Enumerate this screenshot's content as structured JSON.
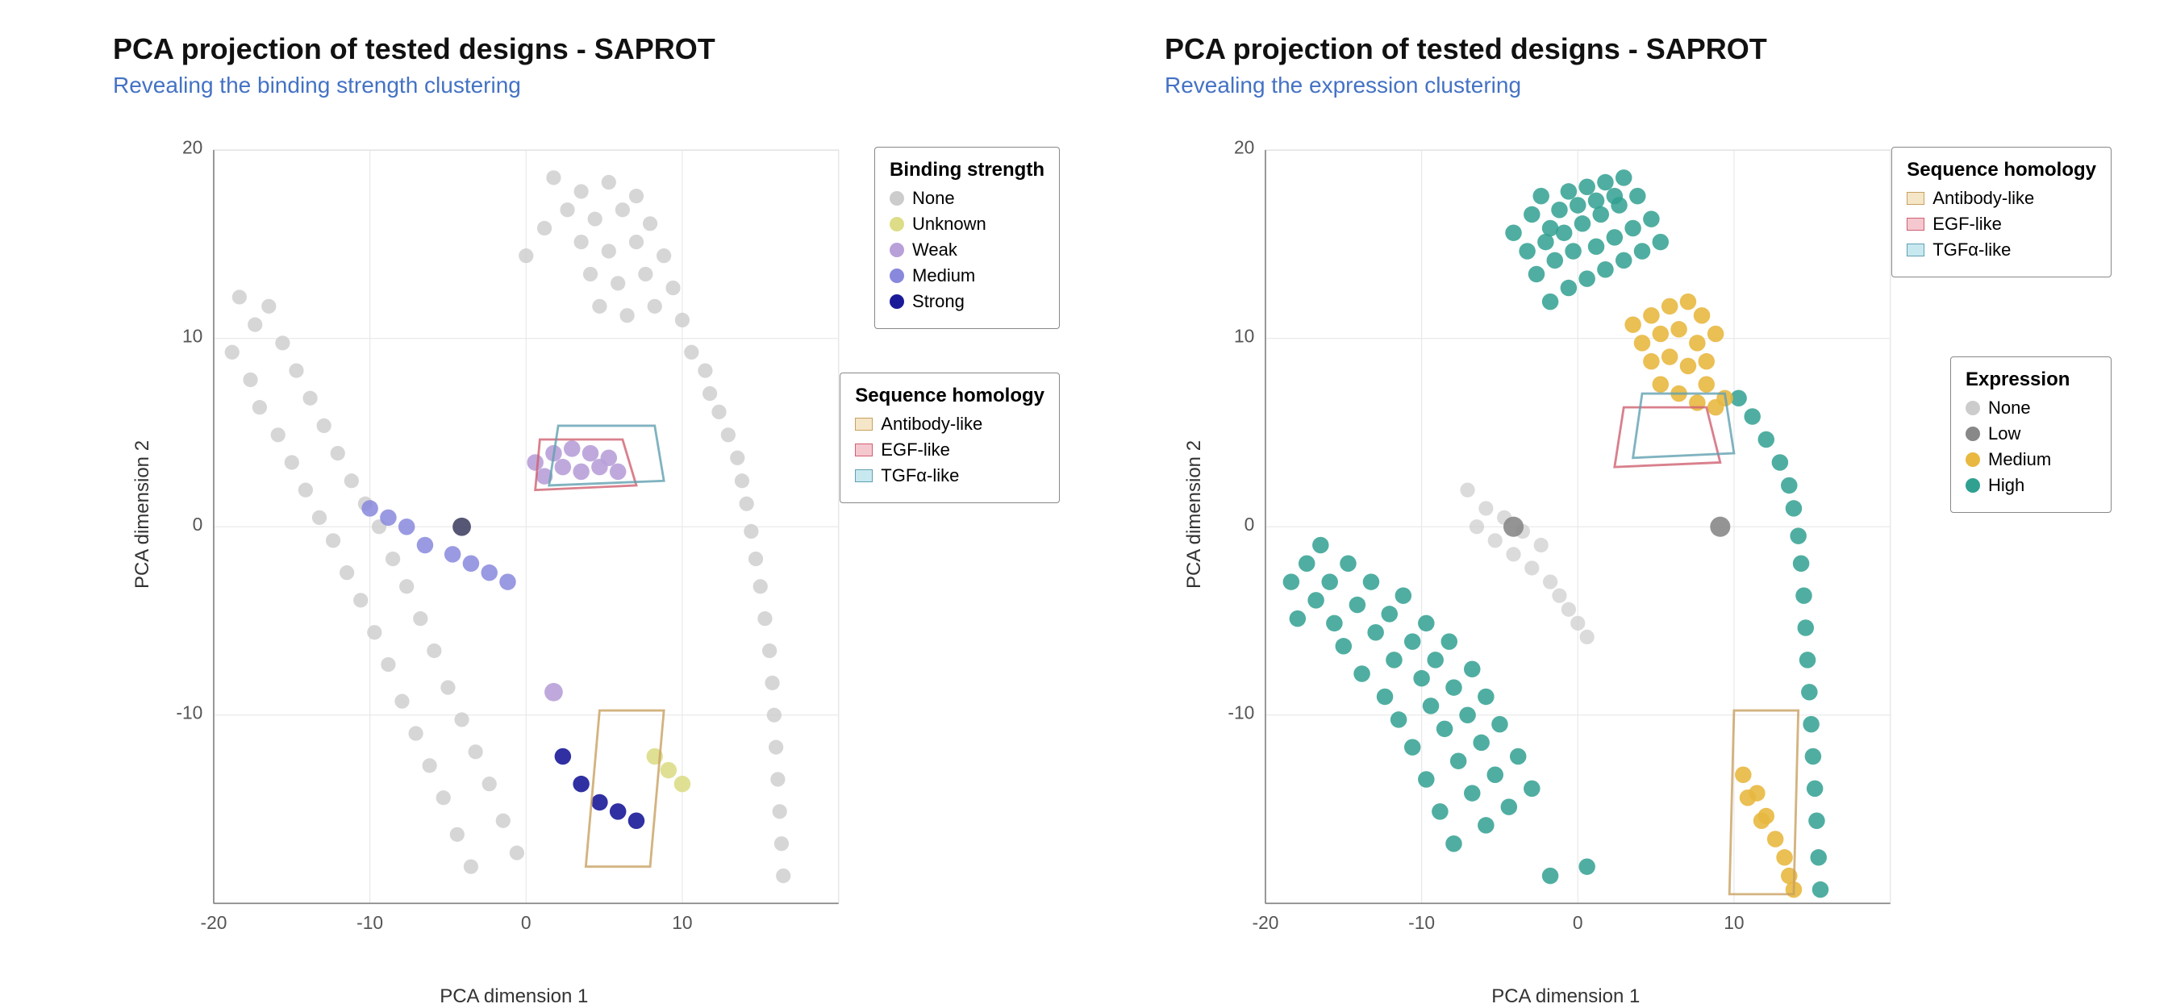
{
  "leftChart": {
    "title": "PCA projection of tested designs - SAPROT",
    "subtitle": "Revealing the binding strength clustering",
    "xLabel": "PCA dimension 1",
    "yLabel": "PCA dimension 2",
    "xTicks": [
      "-20",
      "-10",
      "0",
      "10"
    ],
    "yTicks": [
      "20",
      "10",
      "0",
      "-10"
    ],
    "bindingLegend": {
      "title": "Binding strength",
      "items": [
        {
          "label": "None",
          "color": "#cccccc"
        },
        {
          "label": "Unknown",
          "color": "#ffffaa"
        },
        {
          "label": "Weak",
          "color": "#b8a0d8"
        },
        {
          "label": "Medium",
          "color": "#8888dd"
        },
        {
          "label": "Strong",
          "color": "#1a1a99"
        }
      ]
    },
    "seqHomologyLegend": {
      "title": "Sequence homology",
      "items": [
        {
          "label": "Antibody-like",
          "color": "#f5e6c8",
          "borderColor": "#c8a060"
        },
        {
          "label": "EGF-like",
          "color": "#f5c8d0",
          "borderColor": "#d06070"
        },
        {
          "label": "TGFα-like",
          "color": "#c8e8f0",
          "borderColor": "#60a0b0"
        }
      ]
    }
  },
  "rightChart": {
    "title": "PCA projection of tested designs - SAPROT",
    "subtitle": "Revealing the expression clustering",
    "xLabel": "PCA dimension 1",
    "yLabel": "PCA dimension 2",
    "xTicks": [
      "-20",
      "-10",
      "0",
      "10"
    ],
    "yTicks": [
      "20",
      "10",
      "0",
      "-10"
    ],
    "seqHomologyLegend": {
      "title": "Sequence homology",
      "items": [
        {
          "label": "Antibody-like",
          "color": "#f5e6c8",
          "borderColor": "#c8a060"
        },
        {
          "label": "EGF-like",
          "color": "#f5c8d0",
          "borderColor": "#d06070"
        },
        {
          "label": "TGFα-like",
          "color": "#c8e8f0",
          "borderColor": "#60a0b0"
        }
      ]
    },
    "expressionLegend": {
      "title": "Expression",
      "items": [
        {
          "label": "None",
          "color": "#cccccc"
        },
        {
          "label": "Low",
          "color": "#888888"
        },
        {
          "label": "Medium",
          "color": "#e8b840"
        },
        {
          "label": "High",
          "color": "#30a090"
        }
      ]
    }
  }
}
